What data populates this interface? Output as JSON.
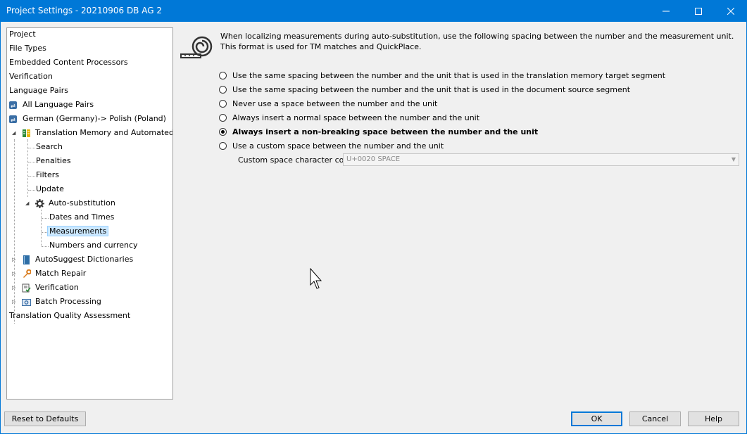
{
  "window": {
    "title": "Project Settings - 20210906 DB AG 2"
  },
  "tree": [
    {
      "label": "Project"
    },
    {
      "label": "File Types"
    },
    {
      "label": "Embedded Content Processors"
    },
    {
      "label": "Verification"
    },
    {
      "label": "Language Pairs"
    },
    {
      "label": "All Language Pairs"
    },
    {
      "label": "German (Germany)-> Polish (Poland)"
    },
    {
      "label": "Translation Memory and Automated Translation"
    },
    {
      "label": "Search"
    },
    {
      "label": "Penalties"
    },
    {
      "label": "Filters"
    },
    {
      "label": "Update"
    },
    {
      "label": "Auto-substitution"
    },
    {
      "label": "Dates and Times"
    },
    {
      "label": "Measurements"
    },
    {
      "label": "Numbers and currency"
    },
    {
      "label": "AutoSuggest Dictionaries"
    },
    {
      "label": "Match Repair"
    },
    {
      "label": "Verification"
    },
    {
      "label": "Batch Processing"
    },
    {
      "label": "Translation Quality Assessment"
    }
  ],
  "main": {
    "description": "When localizing measurements during auto-substitution, use the following spacing between the number and the measurement unit. This format is used for TM matches and QuickPlace.",
    "options": [
      {
        "label": "Use the same spacing between the number and the unit that is used in the translation memory target segment",
        "selected": false
      },
      {
        "label": "Use the same spacing between the number and the unit that is used in the document source segment",
        "selected": false
      },
      {
        "label": "Never use a space between the number and the unit",
        "selected": false
      },
      {
        "label": "Always insert a normal space between the number and the unit",
        "selected": false
      },
      {
        "label": "Always insert a non-breaking space between the number and the unit",
        "selected": true
      },
      {
        "label": "Use a custom space between the number and the unit",
        "selected": false
      }
    ],
    "custom_label": "Custom space character code:",
    "custom_value": "U+0020 SPACE"
  },
  "buttons": {
    "reset": "Reset to Defaults",
    "ok": "OK",
    "cancel": "Cancel",
    "help": "Help"
  },
  "colors": {
    "titlebar": "#0078d7",
    "selection": "#cce8ff",
    "accent": "#0078d7"
  }
}
